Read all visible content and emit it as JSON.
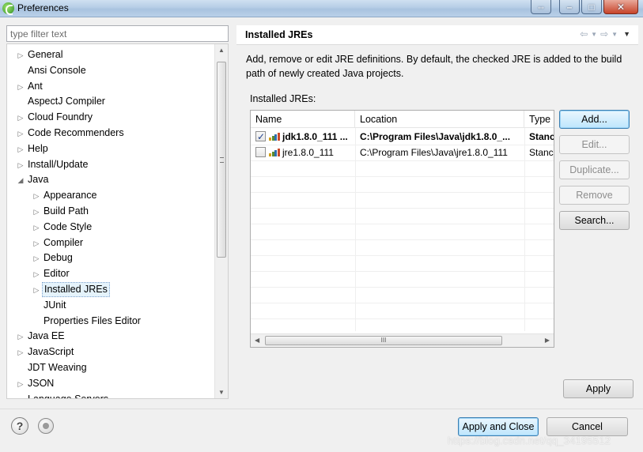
{
  "window": {
    "title": "Preferences"
  },
  "filter": {
    "placeholder": "type filter text"
  },
  "tree": [
    {
      "label": "General",
      "twisty": "▷",
      "indent": 0
    },
    {
      "label": "Ansi Console",
      "twisty": "",
      "indent": 0
    },
    {
      "label": "Ant",
      "twisty": "▷",
      "indent": 0
    },
    {
      "label": "AspectJ Compiler",
      "twisty": "",
      "indent": 0
    },
    {
      "label": "Cloud Foundry",
      "twisty": "▷",
      "indent": 0
    },
    {
      "label": "Code Recommenders",
      "twisty": "▷",
      "indent": 0
    },
    {
      "label": "Help",
      "twisty": "▷",
      "indent": 0
    },
    {
      "label": "Install/Update",
      "twisty": "▷",
      "indent": 0
    },
    {
      "label": "Java",
      "twisty": "◢",
      "indent": 0
    },
    {
      "label": "Appearance",
      "twisty": "▷",
      "indent": 1
    },
    {
      "label": "Build Path",
      "twisty": "▷",
      "indent": 1
    },
    {
      "label": "Code Style",
      "twisty": "▷",
      "indent": 1
    },
    {
      "label": "Compiler",
      "twisty": "▷",
      "indent": 1
    },
    {
      "label": "Debug",
      "twisty": "▷",
      "indent": 1
    },
    {
      "label": "Editor",
      "twisty": "▷",
      "indent": 1
    },
    {
      "label": "Installed JREs",
      "twisty": "▷",
      "indent": 1,
      "selected": true
    },
    {
      "label": "JUnit",
      "twisty": "",
      "indent": 1
    },
    {
      "label": "Properties Files Editor",
      "twisty": "",
      "indent": 1
    },
    {
      "label": "Java EE",
      "twisty": "▷",
      "indent": 0
    },
    {
      "label": "JavaScript",
      "twisty": "▷",
      "indent": 0
    },
    {
      "label": "JDT Weaving",
      "twisty": "",
      "indent": 0
    },
    {
      "label": "JSON",
      "twisty": "▷",
      "indent": 0
    },
    {
      "label": "Language Servers",
      "twisty": "",
      "indent": 0
    }
  ],
  "page": {
    "title": "Installed JREs",
    "description": "Add, remove or edit JRE definitions. By default, the checked JRE is added to the build path of newly created Java projects.",
    "list_label": "Installed JREs:"
  },
  "table": {
    "columns": [
      "Name",
      "Location",
      "Type"
    ],
    "rows": [
      {
        "checked": true,
        "name": "jdk1.8.0_111 ...",
        "location": "C:\\Program Files\\Java\\jdk1.8.0_...",
        "type": "Stanc",
        "bold": true
      },
      {
        "checked": false,
        "name": "jre1.8.0_111",
        "location": "C:\\Program Files\\Java\\jre1.8.0_111",
        "type": "Stanc",
        "bold": false
      }
    ],
    "scroll_thumb_glyph": "III"
  },
  "buttons": {
    "add": "Add...",
    "edit": "Edit...",
    "duplicate": "Duplicate...",
    "remove": "Remove",
    "search": "Search...",
    "apply": "Apply",
    "apply_close": "Apply and Close",
    "cancel": "Cancel"
  },
  "watermark": "https://blog.csdn.net/qq_34195512",
  "colors": {
    "selection": "#e5f3fb",
    "default_button": "#bee6fd"
  }
}
